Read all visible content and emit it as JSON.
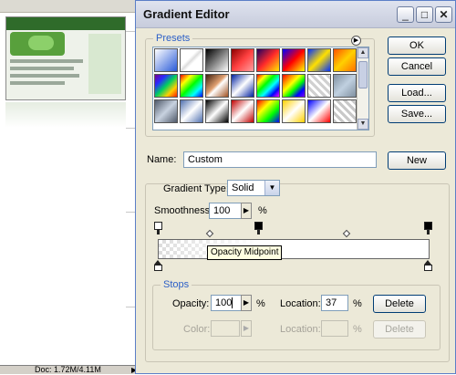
{
  "status_bar": {
    "doc_info": "Doc: 1.72M/4.11M",
    "nav_arrow": "▶"
  },
  "dialog": {
    "title": "Gradient Editor",
    "controls": {
      "minimize": "_",
      "maximize": "□",
      "close": "✕"
    },
    "presets": {
      "legend": "Presets",
      "menu_icon": "▶",
      "swatches": [
        "linear-gradient(135deg,#ffffff,#2a5bd8)",
        "linear-gradient(135deg,#ffffff,#ffffff 40%,#dddddd 50%,#ffffff 60%)",
        "linear-gradient(135deg,#000000,#ffffff)",
        "linear-gradient(135deg,#8b0000,#ff4040 50%,#ffa0a0)",
        "linear-gradient(135deg,#200060,#ff2a2a 50%,#ffea00)",
        "linear-gradient(135deg,#0000ff,#ff0000 50%,#ffff00)",
        "linear-gradient(135deg,#0030ff,#ffe000 50%,#0030ff)",
        "linear-gradient(135deg,#ff5000,#ffd000 50%,#ff7000)",
        "linear-gradient(135deg,#7a0090,#2a2aff 25%,#00d060 50%,#ffd000 75%,#ff2000)",
        "linear-gradient(135deg,#ff0000,#ffff00 25%,#00ff00 50%,#00ffff 75%,#0000ff)",
        "linear-gradient(135deg,#402010,#e0a070 45%,#ffffff 55%,#a05020)",
        "linear-gradient(135deg,#0020a0,#ffffff 50%,#0020a0)",
        "linear-gradient(135deg,#ff0000,#ffff00 20%,#00ff00 40%,#00ffff 60%,#0000ff 80%,#ff00ff)",
        "linear-gradient(135deg,#ff0000,#ff8000 20%,#ffff00 40%,#00ff00 60%,#0000ff 80%,#8000ff)",
        "repeating-linear-gradient(45deg,#d0d0d0 0 3px,#ffffff 3px 6px)",
        "linear-gradient(135deg,#8090a0,#c0d0e0 50%,#8090a0)",
        "linear-gradient(135deg,#505a6a,#c8d2e0 50%,#505a6a)",
        "linear-gradient(135deg,#5070b0,#ffffff 50%,#5070b0)",
        "linear-gradient(135deg,#000000,#ffffff 50%,#000000)",
        "linear-gradient(135deg,#c00000,#ffffff 50%,#c00000)",
        "linear-gradient(135deg,#ff0000,#ffff00 33%,#00ff00 66%,#0000ff)",
        "linear-gradient(135deg,#ffd000,#ffffff 50%,#ffd000)",
        "linear-gradient(135deg,#0000ff,#ffffff 50%,#ff0000)",
        "repeating-linear-gradient(45deg,#c8c8c8 0 3px,#ffffff 3px 6px)"
      ]
    },
    "buttons": {
      "ok": "OK",
      "cancel": "Cancel",
      "load": "Load...",
      "save": "Save...",
      "new": "New"
    },
    "name": {
      "label": "Name:",
      "value": "Custom"
    },
    "gradient": {
      "type_label": "Gradient Type:",
      "type_value": "Solid",
      "smoothness_label": "Smoothness:",
      "smoothness_value": "100",
      "smoothness_unit": "%",
      "tooltip": "Opacity Midpoint"
    },
    "stops": {
      "legend": "Stops",
      "opacity_label": "Opacity:",
      "opacity_value": "100",
      "opacity_unit": "%",
      "opacity_location_label": "Location:",
      "opacity_location_value": "37",
      "opacity_location_unit": "%",
      "opacity_delete": "Delete",
      "color_label": "Color:",
      "color_location_label": "Location:",
      "color_location_unit": "%",
      "color_delete": "Delete"
    }
  }
}
